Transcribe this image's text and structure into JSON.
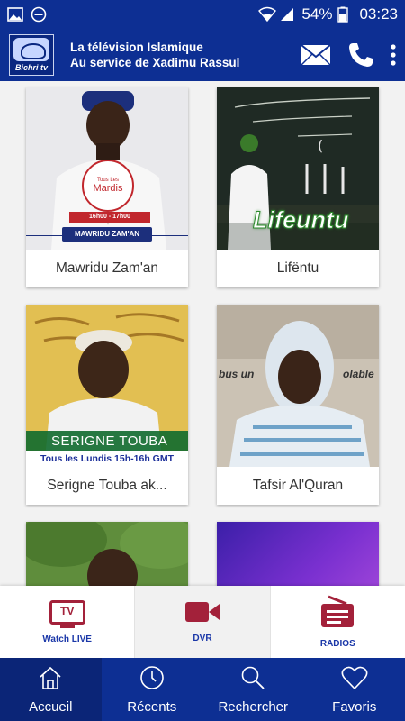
{
  "status_bar": {
    "battery": "54%",
    "time": "03:23"
  },
  "header": {
    "logo_text": "Bichri tv",
    "title_line1": "La télévision Islamique",
    "title_line2": "Au service de Xadimu Rassul"
  },
  "cards": [
    {
      "label": "Mawridu Zam'an",
      "overlay": {
        "day_small": "Tous Les",
        "day": "Mardis",
        "time": "16h00 - 17h00",
        "banner": "MAWRIDU ZAM'AN"
      }
    },
    {
      "label": "Lifëntu",
      "overlay": {
        "banner": "Lifeuntu"
      }
    },
    {
      "label": "Serigne Touba ak...",
      "overlay": {
        "banner": "SERIGNE TOUBA",
        "schedule": "Tous les Lundis 15h-16h GMT"
      }
    },
    {
      "label": "Tafsir Al'Quran",
      "overlay": {
        "bg_text_left": "bus un",
        "bg_text_right": "olable"
      }
    },
    {
      "label": ""
    },
    {
      "label": ""
    }
  ],
  "quickbar": {
    "live": "Watch LIVE",
    "live_icon_text": "TV",
    "dvr": "DVR",
    "radios": "RADIOS"
  },
  "bottom_nav": {
    "home": "Accueil",
    "recent": "Récents",
    "search": "Rechercher",
    "favorites": "Favoris"
  },
  "colors": {
    "brand_blue": "#0d2f93",
    "accent_red": "#a3213a",
    "link_blue": "#1a37a8"
  }
}
